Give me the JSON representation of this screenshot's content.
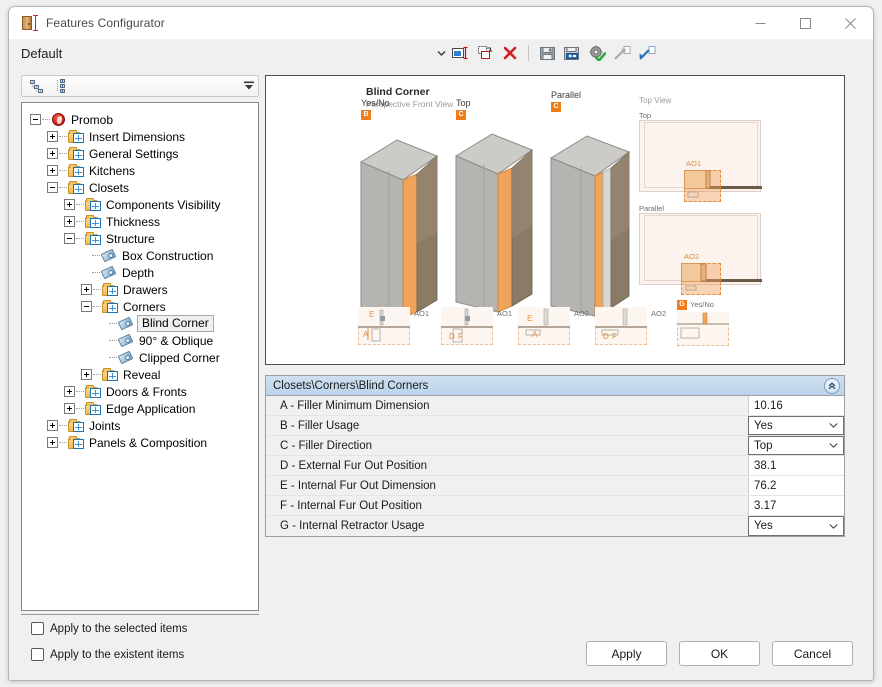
{
  "window": {
    "title": "Features Configurator",
    "icon": "cabinet-dimension-icon",
    "controls": {
      "minimize": "minimize-icon",
      "maximize": "maximize-icon",
      "close": "close-icon"
    }
  },
  "profile": {
    "name": "Default",
    "dropdown_icon": "chevron-down-icon"
  },
  "toolbar": {
    "buttons": [
      {
        "name": "rename-icon",
        "title": "Rename"
      },
      {
        "name": "duplicate-icon",
        "title": "Duplicate"
      },
      {
        "name": "delete-icon",
        "title": "Delete"
      },
      {
        "name": "save-icon",
        "title": "Save"
      },
      {
        "name": "save-as-icon",
        "title": "Save As"
      },
      {
        "name": "settings-check-icon",
        "title": "Validate Settings"
      },
      {
        "name": "export-icon",
        "title": "Export"
      },
      {
        "name": "import-icon",
        "title": "Import"
      }
    ]
  },
  "tree_toolbar": {
    "buttons": [
      {
        "name": "collapse-all-icon",
        "title": "Collapse All"
      },
      {
        "name": "expand-all-icon",
        "title": "Expand All"
      }
    ],
    "overflow_icon": "overflow-chevron-icon"
  },
  "tree": {
    "nodes": [
      {
        "label": "Promob",
        "depth": 0,
        "expander": "minus",
        "icon": "promob-icon",
        "selected": false
      },
      {
        "label": "Insert Dimensions",
        "depth": 1,
        "expander": "plus",
        "icon": "folder-icon",
        "selected": false
      },
      {
        "label": "General Settings",
        "depth": 1,
        "expander": "plus",
        "icon": "folder-icon",
        "selected": false
      },
      {
        "label": "Kitchens",
        "depth": 1,
        "expander": "plus",
        "icon": "folder-icon",
        "selected": false
      },
      {
        "label": "Closets",
        "depth": 1,
        "expander": "minus",
        "icon": "folder-icon",
        "selected": false
      },
      {
        "label": "Components Visibility",
        "depth": 2,
        "expander": "plus",
        "icon": "folder-icon",
        "selected": false
      },
      {
        "label": "Thickness",
        "depth": 2,
        "expander": "plus",
        "icon": "folder-icon",
        "selected": false
      },
      {
        "label": "Structure",
        "depth": 2,
        "expander": "minus",
        "icon": "folder-icon",
        "selected": false
      },
      {
        "label": "Box Construction",
        "depth": 3,
        "expander": "none",
        "icon": "tag-icon",
        "selected": false
      },
      {
        "label": "Depth",
        "depth": 3,
        "expander": "none",
        "icon": "tag-icon",
        "selected": false
      },
      {
        "label": "Drawers",
        "depth": 3,
        "expander": "plus",
        "icon": "folder-icon",
        "selected": false
      },
      {
        "label": "Corners",
        "depth": 3,
        "expander": "minus",
        "icon": "folder-icon",
        "selected": false
      },
      {
        "label": "Blind Corner",
        "depth": 4,
        "expander": "none",
        "icon": "tag-icon",
        "selected": true
      },
      {
        "label": "90° & Oblique",
        "depth": 4,
        "expander": "none",
        "icon": "tag-icon",
        "selected": false
      },
      {
        "label": "Clipped Corner",
        "depth": 4,
        "expander": "none",
        "icon": "tag-icon",
        "selected": false
      },
      {
        "label": "Reveal",
        "depth": 3,
        "expander": "plus",
        "icon": "folder-icon",
        "selected": false
      },
      {
        "label": "Doors & Fronts",
        "depth": 2,
        "expander": "plus",
        "icon": "folder-icon",
        "selected": false
      },
      {
        "label": "Edge Application",
        "depth": 2,
        "expander": "plus",
        "icon": "folder-icon",
        "selected": false
      },
      {
        "label": "Joints",
        "depth": 1,
        "expander": "plus",
        "icon": "folder-icon",
        "selected": false
      },
      {
        "label": "Panels & Composition",
        "depth": 1,
        "expander": "plus",
        "icon": "folder-icon",
        "selected": false
      }
    ]
  },
  "preview": {
    "title": "Blind Corner",
    "subtitle": "Perspective Front View",
    "top_view_label": "Top View",
    "cabinets": [
      {
        "label": "Yes/No",
        "badge": "B"
      },
      {
        "label": "Top",
        "badge": "C"
      },
      {
        "label": "Parallel",
        "badge": "C"
      }
    ],
    "top_views": [
      {
        "label": "Top",
        "code": "AO1"
      },
      {
        "label": "Parallel",
        "code": "AO2"
      }
    ],
    "details": [
      {
        "code": "AO1",
        "letters": [
          "E",
          "A"
        ]
      },
      {
        "code": "AO1",
        "letters": [
          "D",
          "F"
        ]
      },
      {
        "code": "AO2",
        "letters": [
          "E",
          "A"
        ]
      },
      {
        "code": "AO2",
        "letters": [
          "D",
          "F"
        ]
      }
    ],
    "retractor_detail": {
      "badge": "G",
      "label": "Yes/No"
    }
  },
  "properties": {
    "header": "Closets\\Corners\\Blind Corners",
    "collapse_icon": "chevron-double-up-icon",
    "rows": [
      {
        "label": "A - Filler Minimum Dimension",
        "value": "10.16",
        "type": "text"
      },
      {
        "label": "B - Filler Usage",
        "value": "Yes",
        "type": "combo"
      },
      {
        "label": "C - Filler Direction",
        "value": "Top",
        "type": "combo"
      },
      {
        "label": "D - External Fur Out Position",
        "value": "38.1",
        "type": "text"
      },
      {
        "label": "E - Internal Fur Out Dimension",
        "value": "76.2",
        "type": "text"
      },
      {
        "label": "F - Internal Fur Out Position",
        "value": "3.17",
        "type": "text"
      },
      {
        "label": "G - Internal Retractor Usage",
        "value": "Yes",
        "type": "combo"
      }
    ]
  },
  "footer": {
    "checkboxes": [
      {
        "label": "Apply to the selected items",
        "checked": false
      },
      {
        "label": "Apply to the existent items",
        "checked": false
      }
    ],
    "buttons": [
      {
        "label": "Apply"
      },
      {
        "label": "OK"
      },
      {
        "label": "Cancel"
      }
    ]
  },
  "colors": {
    "accent_orange": "#f07d1a",
    "header_blue": "#bcd4ea",
    "window_bg": "#f0f0f0",
    "border": "#828790"
  }
}
